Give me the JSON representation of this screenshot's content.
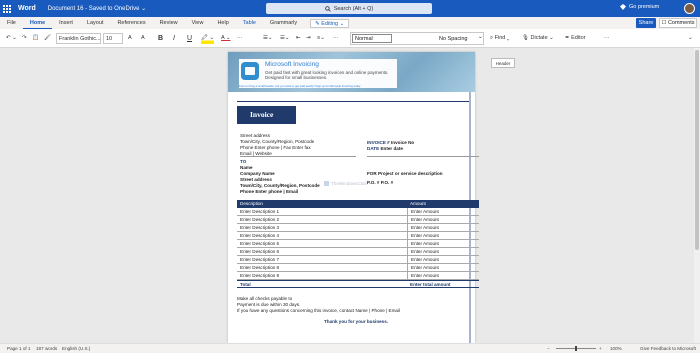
{
  "titlebar": {
    "app_name": "Word",
    "doc_title": "Document 16  -  Saved to OneDrive",
    "doc_caret": "⌄",
    "search_placeholder": "Search (Alt + Q)",
    "premium_label": "Go premium"
  },
  "menu": {
    "items": [
      "File",
      "Home",
      "Insert",
      "Layout",
      "References",
      "Review",
      "View",
      "Help",
      "Table",
      "Grammarly"
    ],
    "active": "Home",
    "editing_label": "Editing",
    "share_label": "Share",
    "comments_label": "Comments"
  },
  "ribbon": {
    "font_name": "Franklin Gothic...",
    "font_size": "10",
    "bold": "B",
    "italic": "I",
    "underline": "U",
    "style_current": "Normal",
    "style_next": "No Spacing",
    "find_label": "Find",
    "dictate_label": "Dictate",
    "editor_label": "Editor"
  },
  "document": {
    "header_tag": "Header",
    "promo": {
      "title": "Microsoft Invoicing",
      "line1": "Get paid fast with great looking invoices and online payments.",
      "line2": "Designed for small businesses.",
      "fine_print": "Free to bring a small freebie, but you want to get paid easily? Sign up for Microsoft Invoicing today"
    },
    "invoice_title": "Invoice",
    "sender": [
      "Street address",
      "Town/City, County/Region, Postcode",
      "Phone Enter phone | Fax Enter fax",
      "Email | Website"
    ],
    "invoice_no_label": "INVOICE",
    "invoice_no_value": "# Invoice No",
    "date_label": "DATE",
    "date_value": "Enter date",
    "to_label": "TO",
    "recipient": [
      "Name",
      "Company Name",
      "Street address",
      "Town/City, County/Region, Postcode",
      "Phone Enter phone | Email"
    ],
    "for_line": "FOR Project or service description",
    "po_line": "P.O. # P.O. #",
    "watermark": "TheWindowsClub",
    "table": {
      "headers": [
        "Description",
        "Amount"
      ],
      "rows": [
        [
          "Enter Description 1",
          "Enter Amount"
        ],
        [
          "Enter Description 2",
          "Enter Amount"
        ],
        [
          "Enter Description 3",
          "Enter Amount"
        ],
        [
          "Enter Description 4",
          "Enter Amount"
        ],
        [
          "Enter Description 5",
          "Enter Amount"
        ],
        [
          "Enter Description 6",
          "Enter Amount"
        ],
        [
          "Enter Description 7",
          "Enter Amount"
        ],
        [
          "Enter Description 8",
          "Enter Amount"
        ],
        [
          "Enter Description 9",
          "Enter Amount"
        ]
      ],
      "total_label": "Total",
      "total_value": "Enter total amount"
    },
    "footer_lines": [
      "Make all checks payable to",
      "Payment is due within 30 days.",
      "If you have any questions concerning this invoice, contact Name | Phone | Email"
    ],
    "thanks": "Thank you for your business."
  },
  "status": {
    "page": "Page 1 of 1",
    "words": "187 words",
    "language": "English (U.S.)",
    "zoom_minus": "−",
    "zoom": "100%",
    "zoom_plus": "+",
    "feedback": "Give Feedback to Microsoft"
  },
  "colors": {
    "brand": "#185abd",
    "invoice_navy": "#1f3a6b"
  }
}
